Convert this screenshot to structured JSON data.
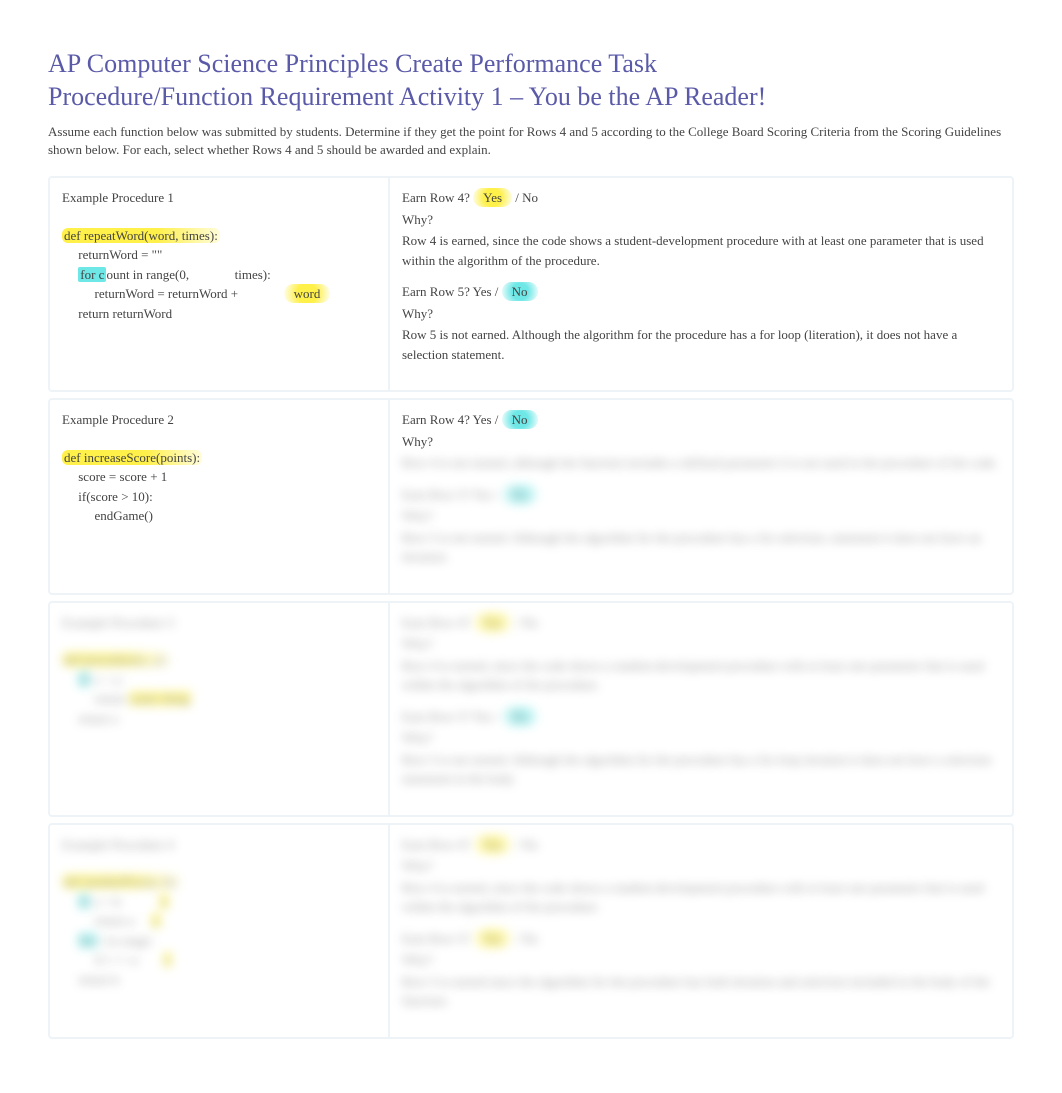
{
  "title_line1": "AP Computer Science Principles Create Performance Task",
  "title_line2": "Procedure/Function Requirement Activity 1 – You be the AP Reader!",
  "intro": "Assume each function below was submitted by students. Determine if they get the point for Rows 4 and 5 according to the College Board Scoring Criteria from the Scoring Guidelines shown below.       For each, select whether Rows 4 and 5 should be awarded and explain.",
  "rows": [
    {
      "proc_title": "Example Procedure 1",
      "code": {
        "l1_pre": "def repeatWord(word, times):",
        "l2": "     returnWord = \"\"",
        "l3_a": "     ",
        "l3_b": "for c",
        "l3_c": "ount in range(0,              ",
        "l3_d": "times):",
        "l4_a": "          returnWord = returnWord +              ",
        "l4_b": "word",
        "l5": "     return returnWord"
      },
      "r4_q": "Earn Row 4?     ",
      "r4_yes": "Yes",
      "r4_sep": " / No",
      "r4_why": "Why?",
      "r4_ans": "Row 4 is earned, since the code shows a student-development procedure with at least one parameter that is used within the algorithm of the procedure.",
      "r5_q": "Earn Row 5? Yes /      ",
      "r5_no": "No",
      "r5_why": "Why?",
      "r5_ans": "Row 5 is not earned. Although the algorithm for the procedure has a for loop (literation), it does not have a selection statement."
    },
    {
      "proc_title": "Example Procedure 2",
      "code": {
        "l1_pre": "def increaseScore(points):",
        "l2": "     score = score + 1",
        "l3": "     if(score > 10):",
        "l4": "          endGame()"
      },
      "r4_q": "Earn Row 4? Yes /      ",
      "r4_no": "No",
      "r4_why": "Why?",
      "r4_ans_blur": "Row 4 is not earned, although the function includes a defined parameter it is not used in the procedure of the code.",
      "r5_q": "Earn Row 5? Yes /      ",
      "r5_no": "No",
      "r5_why": "Why?",
      "r5_ans_blur": "Row 5 is not earned. Although the algorithm for the procedure has a for selection, statement it does not have an iteration."
    },
    {
      "proc_title": "Example Procedure 3",
      "code_blur": "def procedure(x, y):\n     if x > y:\n          return something\n     for i in range(0, y):\n          do stuff\n     return x",
      "r4_q": "Earn Row 4?     ",
      "r4_yes": "Yes",
      "r4_sep": " / No",
      "r4_why": "Why?",
      "r4_ans_blur": "Row 4 is earned, since the code shows a student-development procedure with at least one parameter that is used within the algorithm of the procedure.",
      "r5_q": "Earn Row 5? Yes /      ",
      "r5_no": "No",
      "r5_why": "Why?",
      "r5_ans_blur": "Row 5 is not earned. Although the algorithm for the procedure has a for loop iteration it does not have a selection statement in the body."
    },
    {
      "proc_title": "Example Procedure 4",
      "code_blur": "def anotherProc(a, b):\n     if a > b:\n          return a\n     for i in range(0, b):\n          if i == a:\n               do thing\n     return b",
      "r4_q": "Earn Row 4?     ",
      "r4_yes": "Yes",
      "r4_sep": " / No",
      "r4_why": "Why?",
      "r4_ans_blur": "Row 4 is earned, since the code shows a student-development procedure with at least one parameter that is used within the algorithm of the procedure.",
      "r5_q": "Earn Row 5?     ",
      "r5_yes": "Yes",
      "r5_sep": " / No",
      "r5_why": "Why?",
      "r5_ans_blur": "Row 5 is earned since the algorithm for the procedure has both iteration and selection included in the body of the function."
    }
  ]
}
